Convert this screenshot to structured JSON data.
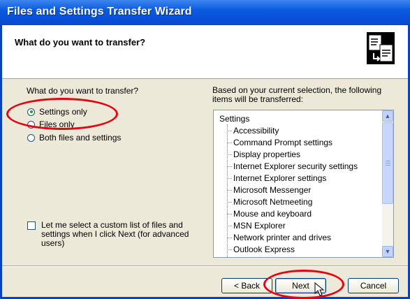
{
  "window": {
    "title": "Files and Settings Transfer Wizard"
  },
  "header": {
    "title": "What do you want to transfer?",
    "icon": "transfer-wizard-icon"
  },
  "left": {
    "question": "What do you want to transfer?",
    "options": [
      {
        "label": "Settings only",
        "checked": true
      },
      {
        "label": "Files only",
        "checked": false
      },
      {
        "label": "Both files and settings",
        "checked": false
      }
    ],
    "custom_list_label": "Let me select a custom list of files and settings when I click Next (for advanced users)",
    "custom_list_checked": false
  },
  "right": {
    "info": "Based on your current selection, the following items will be transferred:",
    "tree_root": "Settings",
    "tree_items": [
      "Accessibility",
      "Command Prompt settings",
      "Display properties",
      "Internet Explorer security settings",
      "Internet Explorer settings",
      "Microsoft Messenger",
      "Microsoft Netmeeting",
      "Mouse and keyboard",
      "MSN Explorer",
      "Network printer and drives",
      "Outlook Express"
    ]
  },
  "buttons": {
    "back": "< Back",
    "next": "Next",
    "cancel": "Cancel"
  },
  "colors": {
    "titlebar": "#0a5ae0",
    "annotation": "#e30613",
    "face": "#ece9d8"
  }
}
